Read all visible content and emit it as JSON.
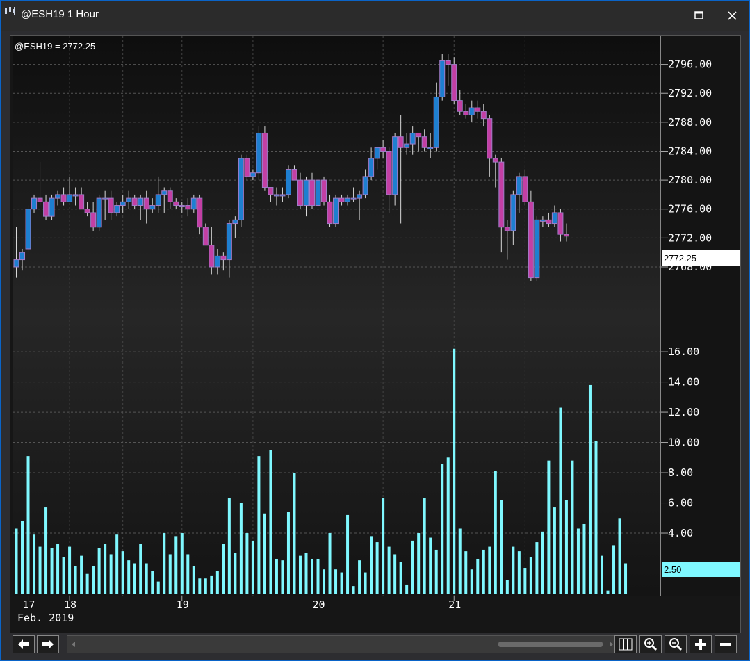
{
  "window": {
    "title": "@ESH19 1 Hour",
    "controls": [
      "maximize",
      "close"
    ]
  },
  "chart_data": [
    {
      "type": "candlestick",
      "symbol_label": "@ESH19 = 2772.25",
      "last_price_label": "2772.25",
      "y_ticks": [
        "2796.00",
        "2792.00",
        "2788.00",
        "2784.00",
        "2780.00",
        "2776.00",
        "2772.00",
        "2768.00"
      ],
      "y_range": [
        2765.5,
        2797.5
      ],
      "x_ticks": [
        "17",
        "18",
        "19",
        "20",
        "21"
      ],
      "x_sublabel": "Feb. 2019",
      "colors": {
        "up_body": "#1e7fd0",
        "down_body": "#c33fa4",
        "body_edge": "#a07cc8",
        "wick": "#d8d8d8"
      },
      "candles": [
        [
          2768.0,
          2773.5,
          2766.5,
          2769.0
        ],
        [
          2769.0,
          2770.5,
          2767.5,
          2770.0
        ],
        [
          2770.5,
          2776.5,
          2770.0,
          2776.0
        ],
        [
          2776.0,
          2778.0,
          2775.5,
          2777.5
        ],
        [
          2777.5,
          2782.5,
          2776.5,
          2777.0
        ],
        [
          2777.0,
          2778.0,
          2774.5,
          2775.0
        ],
        [
          2775.0,
          2778.0,
          2774.5,
          2777.5
        ],
        [
          2777.5,
          2778.5,
          2776.5,
          2778.0
        ],
        [
          2778.0,
          2779.0,
          2776.5,
          2777.0
        ],
        [
          2777.0,
          2780.5,
          2777.0,
          2778.0
        ],
        [
          2778.0,
          2779.0,
          2776.5,
          2778.0
        ],
        [
          2778.0,
          2779.0,
          2776.0,
          2776.0
        ],
        [
          2776.0,
          2777.0,
          2775.0,
          2775.5
        ],
        [
          2775.5,
          2777.0,
          2773.0,
          2773.5
        ],
        [
          2773.5,
          2778.0,
          2773.0,
          2777.5
        ],
        [
          2777.5,
          2778.5,
          2774.5,
          2777.5
        ],
        [
          2777.5,
          2778.5,
          2774.5,
          2775.5
        ],
        [
          2775.5,
          2777.0,
          2775.0,
          2776.5
        ],
        [
          2776.5,
          2778.0,
          2775.5,
          2777.0
        ],
        [
          2777.0,
          2778.5,
          2776.0,
          2777.5
        ],
        [
          2777.5,
          2778.0,
          2776.0,
          2776.5
        ],
        [
          2776.5,
          2778.0,
          2774.5,
          2777.5
        ],
        [
          2777.5,
          2778.5,
          2774.0,
          2776.0
        ],
        [
          2776.0,
          2777.5,
          2775.5,
          2776.5
        ],
        [
          2776.5,
          2780.5,
          2775.5,
          2778.0
        ],
        [
          2778.0,
          2779.0,
          2775.5,
          2778.5
        ],
        [
          2778.5,
          2779.0,
          2776.0,
          2777.0
        ],
        [
          2777.0,
          2777.5,
          2776.0,
          2776.5
        ],
        [
          2776.5,
          2777.0,
          2775.5,
          2776.5
        ],
        [
          2776.5,
          2777.5,
          2775.0,
          2776.0
        ],
        [
          2776.0,
          2778.0,
          2775.5,
          2777.5
        ],
        [
          2777.5,
          2778.0,
          2772.5,
          2773.5
        ],
        [
          2773.5,
          2774.0,
          2771.0,
          2771.0
        ],
        [
          2771.0,
          2773.5,
          2767.0,
          2768.0
        ],
        [
          2768.0,
          2770.5,
          2767.0,
          2769.5
        ],
        [
          2769.5,
          2770.0,
          2767.5,
          2769.0
        ],
        [
          2769.0,
          2774.5,
          2766.5,
          2774.0
        ],
        [
          2774.0,
          2775.0,
          2772.0,
          2774.5
        ],
        [
          2774.5,
          2783.5,
          2773.5,
          2783.0
        ],
        [
          2783.0,
          2783.5,
          2780.0,
          2780.5
        ],
        [
          2780.5,
          2781.5,
          2780.0,
          2781.0
        ],
        [
          2781.0,
          2787.5,
          2780.0,
          2786.5
        ],
        [
          2786.5,
          2787.5,
          2778.5,
          2779.0
        ],
        [
          2779.0,
          2779.0,
          2777.0,
          2778.0
        ],
        [
          2778.0,
          2779.0,
          2776.5,
          2778.0
        ],
        [
          2778.0,
          2779.0,
          2777.0,
          2778.0
        ],
        [
          2778.0,
          2782.0,
          2777.5,
          2781.5
        ],
        [
          2781.5,
          2782.0,
          2780.0,
          2780.0
        ],
        [
          2780.0,
          2781.0,
          2776.0,
          2776.5
        ],
        [
          2776.5,
          2780.5,
          2775.0,
          2780.0
        ],
        [
          2780.0,
          2781.0,
          2776.0,
          2776.5
        ],
        [
          2776.5,
          2780.5,
          2776.0,
          2780.0
        ],
        [
          2780.0,
          2780.5,
          2776.5,
          2777.0
        ],
        [
          2777.0,
          2778.0,
          2773.5,
          2774.0
        ],
        [
          2774.0,
          2778.0,
          2773.5,
          2777.5
        ],
        [
          2777.5,
          2778.0,
          2776.5,
          2777.0
        ],
        [
          2777.0,
          2778.0,
          2776.5,
          2777.5
        ],
        [
          2777.5,
          2779.0,
          2777.0,
          2777.5
        ],
        [
          2777.5,
          2778.5,
          2774.5,
          2778.0
        ],
        [
          2778.0,
          2781.5,
          2777.5,
          2780.5
        ],
        [
          2780.5,
          2784.5,
          2780.0,
          2783.0
        ],
        [
          2783.0,
          2784.5,
          2781.5,
          2784.5
        ],
        [
          2784.5,
          2785.5,
          2783.0,
          2784.0
        ],
        [
          2784.0,
          2784.5,
          2775.5,
          2778.0
        ],
        [
          2778.0,
          2786.5,
          2776.5,
          2786.0
        ],
        [
          2786.0,
          2789.0,
          2774.0,
          2784.5
        ],
        [
          2784.5,
          2786.5,
          2783.5,
          2785.0
        ],
        [
          2785.0,
          2787.5,
          2783.5,
          2786.5
        ],
        [
          2786.5,
          2786.5,
          2784.0,
          2786.0
        ],
        [
          2786.0,
          2787.0,
          2784.0,
          2784.5
        ],
        [
          2784.5,
          2786.5,
          2783.0,
          2784.5
        ],
        [
          2784.5,
          2793.5,
          2784.0,
          2791.5
        ],
        [
          2791.5,
          2797.5,
          2791.0,
          2796.5
        ],
        [
          2796.5,
          2797.5,
          2793.0,
          2796.0
        ],
        [
          2796.0,
          2797.0,
          2790.5,
          2791.0
        ],
        [
          2791.0,
          2792.5,
          2789.0,
          2789.5
        ],
        [
          2789.5,
          2790.5,
          2788.5,
          2789.0
        ],
        [
          2789.0,
          2791.0,
          2788.0,
          2790.0
        ],
        [
          2790.0,
          2791.0,
          2788.5,
          2789.5
        ],
        [
          2789.5,
          2790.5,
          2787.5,
          2788.5
        ],
        [
          2788.5,
          2789.0,
          2780.5,
          2783.0
        ],
        [
          2783.0,
          2783.5,
          2779.0,
          2782.5
        ],
        [
          2782.5,
          2783.0,
          2770.0,
          2773.5
        ],
        [
          2773.5,
          2774.5,
          2769.0,
          2773.0
        ],
        [
          2773.0,
          2778.5,
          2771.0,
          2778.0
        ],
        [
          2778.0,
          2781.0,
          2775.5,
          2780.5
        ],
        [
          2780.5,
          2781.5,
          2776.5,
          2777.0
        ],
        [
          2777.0,
          2778.5,
          2766.0,
          2766.5
        ],
        [
          2766.5,
          2775.0,
          2766.0,
          2774.5
        ],
        [
          2774.5,
          2775.0,
          2773.5,
          2774.5
        ],
        [
          2774.5,
          2775.5,
          2773.5,
          2774.0
        ],
        [
          2774.0,
          2776.5,
          2773.5,
          2775.5
        ],
        [
          2775.5,
          2776.0,
          2771.5,
          2772.5
        ],
        [
          2772.5,
          2774.0,
          2771.5,
          2772.25
        ]
      ]
    },
    {
      "type": "bar",
      "y_ticks": [
        "16.00",
        "14.00",
        "12.00",
        "10.00",
        "8.00",
        "6.00",
        "4.00"
      ],
      "y_range": [
        0.0,
        17.2
      ],
      "last_value_label": "2.50",
      "color": "#7ff8ff",
      "values": [
        4.3,
        4.8,
        9.1,
        3.9,
        3.1,
        5.7,
        3.0,
        3.3,
        2.4,
        3.1,
        1.8,
        2.5,
        1.3,
        1.8,
        3.0,
        3.3,
        2.6,
        3.9,
        2.8,
        2.2,
        2.0,
        3.3,
        2.0,
        1.5,
        0.8,
        4.0,
        2.6,
        3.8,
        4.0,
        2.6,
        1.8,
        1.0,
        1.0,
        1.2,
        1.5,
        3.3,
        6.3,
        2.7,
        6.0,
        4.0,
        3.5,
        9.1,
        5.3,
        9.5,
        2.3,
        2.2,
        5.4,
        8.0,
        2.5,
        2.7,
        2.3,
        2.3,
        1.6,
        4.0,
        1.6,
        1.4,
        5.2,
        0.5,
        2.2,
        1.4,
        3.8,
        3.4,
        6.3,
        3.1,
        2.6,
        2.1,
        0.6,
        3.5,
        4.0,
        6.3,
        3.7,
        2.9,
        8.6,
        9.0,
        16.2,
        4.3,
        2.8,
        1.6,
        2.3,
        2.9,
        3.1,
        8.1,
        6.2,
        0.9,
        3.1,
        2.8,
        1.7,
        2.4,
        3.4,
        4.1,
        8.8,
        5.7,
        12.3,
        6.2,
        8.8,
        4.3,
        4.6,
        13.8,
        10.1,
        2.5,
        0.2,
        3.2,
        5.0,
        2.0
      ]
    }
  ]
}
